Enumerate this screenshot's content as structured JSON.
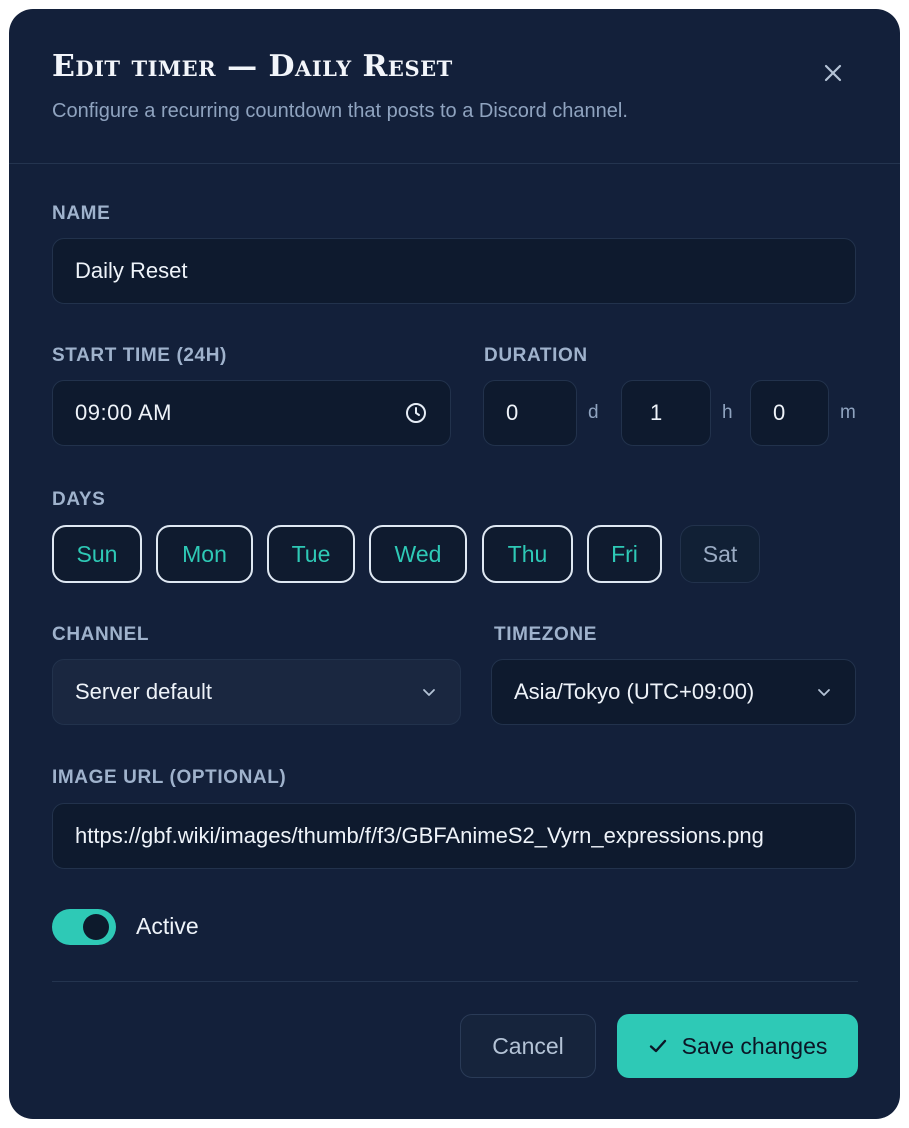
{
  "dialog": {
    "title": "Edit timer — Daily Reset",
    "subtitle": "Configure a recurring countdown that posts to a Discord channel.",
    "close_icon": "close-icon"
  },
  "name": {
    "label": "NAME",
    "value": "Daily Reset"
  },
  "start_time": {
    "label": "START TIME (24H)",
    "value": "09:00 AM",
    "icon": "clock-icon"
  },
  "duration": {
    "label": "DURATION",
    "days": "0",
    "days_unit": "d",
    "hours": "1",
    "hours_unit": "h",
    "minutes": "0",
    "minutes_unit": "m"
  },
  "days": {
    "label": "DAYS",
    "items": [
      {
        "label": "Sun",
        "selected": true
      },
      {
        "label": "Mon",
        "selected": true
      },
      {
        "label": "Tue",
        "selected": true
      },
      {
        "label": "Wed",
        "selected": true
      },
      {
        "label": "Thu",
        "selected": true
      },
      {
        "label": "Fri",
        "selected": true
      },
      {
        "label": "Sat",
        "selected": false
      }
    ]
  },
  "channel": {
    "label": "CHANNEL",
    "value": "Server default",
    "icon": "chevron-down-icon"
  },
  "timezone": {
    "label": "TIMEZONE",
    "value": "Asia/Tokyo (UTC+09:00)",
    "icon": "chevron-down-icon"
  },
  "image_url": {
    "label": "IMAGE URL (OPTIONAL)",
    "value": "https://gbf.wiki/images/thumb/f/f3/GBFAnimeS2_Vyrn_expressions.png"
  },
  "active": {
    "label": "Active",
    "on": true
  },
  "footer": {
    "cancel_label": "Cancel",
    "save_label": "Save changes",
    "save_icon": "check-icon"
  },
  "colors": {
    "background": "#13203a",
    "accent": "#2ec9b6",
    "input_bg": "#0e1a2e",
    "muted_text": "#8fa3bf"
  }
}
